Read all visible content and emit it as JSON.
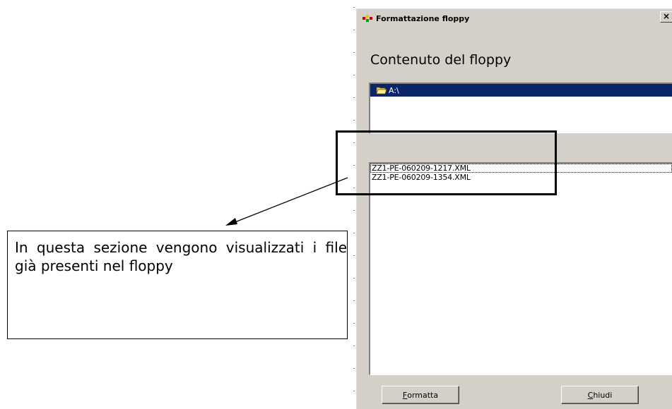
{
  "window": {
    "title": "Formattazione floppy",
    "close_glyph": "×"
  },
  "content": {
    "heading": "Contenuto del floppy",
    "drive_label": "A:\\",
    "files": [
      "ZZ1-PE-060209-1217.XML",
      "ZZ1-PE-060209-1354.XML"
    ]
  },
  "buttons": {
    "format": {
      "mnemonic": "F",
      "rest": "ormatta"
    },
    "close": {
      "mnemonic": "C",
      "rest": "hiudi"
    }
  },
  "annotation": {
    "text": "In questa sezione vengono visualizzati i file già presenti nel floppy"
  },
  "colors": {
    "dialog_face": "#d4d0c8",
    "selection": "#0a246a"
  },
  "icons": {
    "app": "app-icon",
    "folder": "open-folder-icon"
  }
}
